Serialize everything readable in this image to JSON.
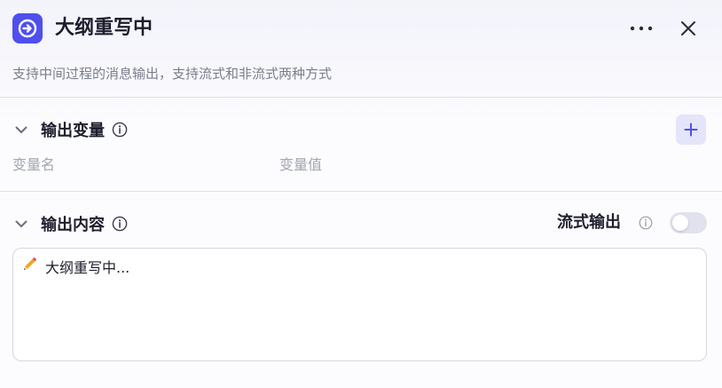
{
  "header": {
    "title": "大纲重写中",
    "app_icon": "arrow-right-circle-icon",
    "more_icon": "more-horizontal-icon",
    "close_icon": "close-icon"
  },
  "description": "支持中间过程的消息输出，支持流式和非流式两种方式",
  "output_variables": {
    "title": "输出变量",
    "add_icon": "plus-icon",
    "columns": [
      "变量名",
      "变量值"
    ]
  },
  "output_content": {
    "title": "输出内容",
    "stream_label": "流式输出",
    "stream_enabled": false,
    "content_icon": "pencil-icon",
    "content_text": "大纲重写中..."
  },
  "colors": {
    "accent": "#4f4fee",
    "add_button_bg": "#e4e4fb",
    "toggle_off": "#e2e2ee",
    "divider": "#dedfe6"
  }
}
